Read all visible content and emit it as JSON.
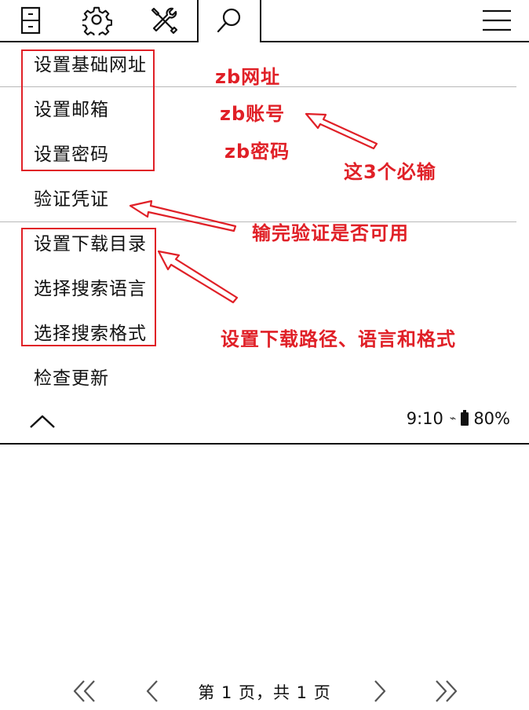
{
  "toolbar": {
    "icons": [
      "file-cabinet-icon",
      "gear-icon",
      "tools-icon",
      "search-icon",
      "hamburger-menu-icon"
    ],
    "active_tab": "search"
  },
  "menu": {
    "items": [
      {
        "label": "设置基础网址"
      },
      {
        "label": "设置邮箱"
      },
      {
        "label": "设置密码"
      },
      {
        "label": "验证凭证"
      },
      {
        "label": "设置下载目录"
      },
      {
        "label": "选择搜索语言"
      },
      {
        "label": "选择搜索格式"
      },
      {
        "label": "检查更新"
      }
    ]
  },
  "status": {
    "time": "9:10",
    "wifi_glyph": "⌁",
    "battery": "80%"
  },
  "annotations": {
    "zb_url": "zb网址",
    "zb_account": "zb账号",
    "zb_password": "zb密码",
    "required_note": "这3个必输",
    "verify_note": "输完验证是否可用",
    "download_note": "设置下载路径、语言和格式",
    "color": "#e02027"
  },
  "pager": {
    "indicator": "第 1 页，共 1 页"
  }
}
